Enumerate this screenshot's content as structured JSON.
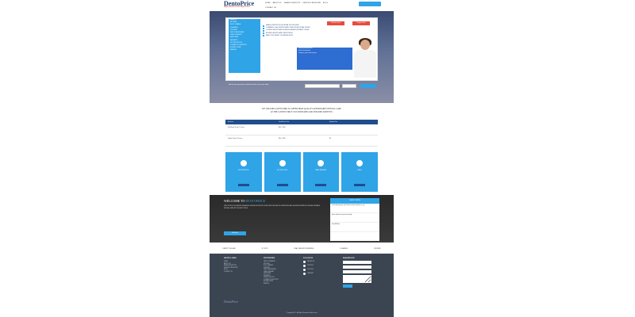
{
  "header": {
    "logo": "DentoPrice",
    "tagline": "Right Dentist at the Right Price",
    "nav": [
      "Home",
      "About Us",
      "Search Dentists",
      "Dentists Register",
      "Blog"
    ],
    "contact": "Contact Us"
  },
  "hero": {
    "title": "FIND THE RIGHT PRICE FOR YOUR NEXT DENTAL PROCEDURE!",
    "subtitle": "TALK TO NEW DENTIST ABOUT OUR PROMOTIONS AND FREEBIES BY REGISTERING WITH US",
    "sidebar": [
      "Search",
      "Fillings",
      "Root Canals",
      "Cleaning",
      "Crowns",
      "Teeth Whitening",
      "Oral Surgery",
      "Dentures",
      "Implants",
      "Orthodontics",
      "Cosmetic Dentistry",
      "Extractions",
      "Braces"
    ],
    "checks": [
      "Search Dentists for Dental Procedures",
      "Compare Local Dentists and Their Promotional Prices",
      "Locate Dentists and Schedule an Appointment Online",
      "Review Dentists and Their Prices",
      "Save Your Money on Dental Work"
    ],
    "btn_red_1": "Get Best Deals",
    "btn_red_2": "Register Now",
    "blue_lines": [
      "Dental procedures list",
      "Find a local dentist",
      "Compare prices and reviews"
    ],
    "search_note": "Find the best procedures and find the dentist in your area today",
    "search_placeholder": "Search Procedure",
    "zip_placeholder": "Zip"
  },
  "network": {
    "line1": "WE CREATED A NETWORK TO OFFER HIGH QUALITY AFFORDABLE DENTAL CARE",
    "line2": "AT THE LOWEST PRICE TO UNINSURED AND INSURED PATIENTS."
  },
  "table": {
    "headers": [
      "Services",
      "DentoPrice Cost",
      "Regular Fee"
    ],
    "rows": [
      [
        "Full Mouth X-ray (2 Years)",
        "$40 - $100",
        "-"
      ],
      [
        "Digital X-Ray (2 Years)",
        "$40 - $100",
        "$0"
      ]
    ]
  },
  "steps": [
    "Find Dentists",
    "Get Discount",
    "Make Payment",
    "Smile"
  ],
  "welcome": {
    "title_pre": "WELCOME TO",
    "title_brand": "DENTOPRICE",
    "text": "DENTOPRICE IS A NEW ALTERNATIVE DENTAL NETWORK PLATFORM THAT HELPS UNINSURED AND INSURED PATIENTS FIND AFFORDABLE DENTAL CARE AT THE BEST PRICE.",
    "read_more": "Read More",
    "news_head": "Latest News",
    "news_items": [
      "Tooth whitening tips and the best treatment options for you",
      "Bonus dental care tips for the family",
      "View All News"
    ]
  },
  "cities": [
    "Liberty Village",
    "St. Kits",
    "Oral Cancer Screening",
    "Cleaning",
    "Crowns"
  ],
  "footer": {
    "col1_title": "Helpful Links",
    "col1": [
      "Home",
      "About Us",
      "Search Dentists",
      "Dentists Register",
      "Blog",
      "Contact Us"
    ],
    "col2_title": "Procedures",
    "col2": [
      "Teeth Cleaning",
      "Fillings",
      "Root Canals",
      "Crowns",
      "Teeth Whitening",
      "Oral Surgery",
      "Dentures",
      "Implants",
      "Orthodontics",
      "Cosmetic Dentistry",
      "Extractions",
      "Braces"
    ],
    "col3_title": "Follow Us",
    "social": [
      "Facebook",
      "Twitter",
      "Google+",
      "LinkedIn"
    ],
    "col4_title": "Enquire Now",
    "enquire_placeholders": [
      "Name",
      "Email",
      "Phone",
      "Message"
    ],
    "copyright": "© Copyright 2017 - All Rights Reserved DentoPrice.com"
  }
}
